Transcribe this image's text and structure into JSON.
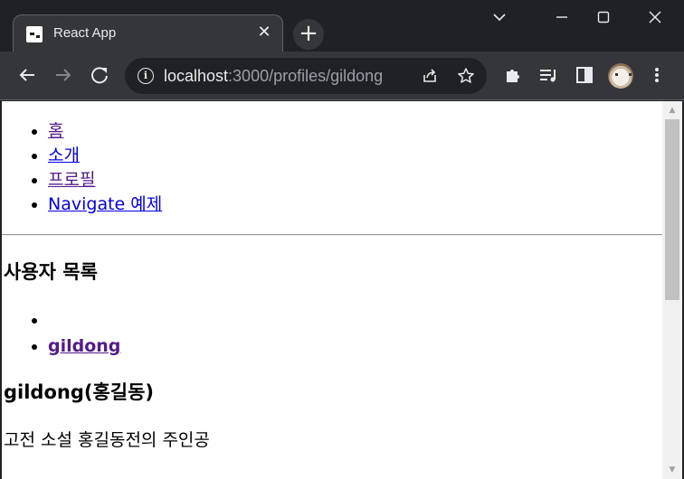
{
  "browser": {
    "tab_title": "React App",
    "tab_close": "✕",
    "new_tab": "+",
    "window_controls": {
      "minimize": "⌄",
      "restore": "—",
      "maximize": "☐",
      "close": "✕"
    },
    "url_host": "localhost",
    "url_path": ":3000/profiles/gildong",
    "icons": [
      "back-icon",
      "forward-icon",
      "reload-icon",
      "info-icon",
      "share-icon",
      "star-icon",
      "extensions-icon",
      "media-icon",
      "side-panel-icon",
      "avatar",
      "menu-icon"
    ]
  },
  "page": {
    "nav": [
      {
        "label": "홈",
        "visited": true
      },
      {
        "label": "소개",
        "visited": false
      },
      {
        "label": "프로필",
        "visited": true
      },
      {
        "label": "Navigate 예제",
        "visited": false
      }
    ],
    "users_heading": "사용자 목록",
    "users": [
      "",
      "gildong"
    ],
    "profile_heading": "gildong(홍길동)",
    "profile_description": "고전 소설 홍길동전의 주인공"
  },
  "colors": {
    "chrome_dark": "#202124",
    "chrome_toolbar": "#35363a",
    "link": "#0000ee",
    "visited_link": "#551a8b"
  }
}
